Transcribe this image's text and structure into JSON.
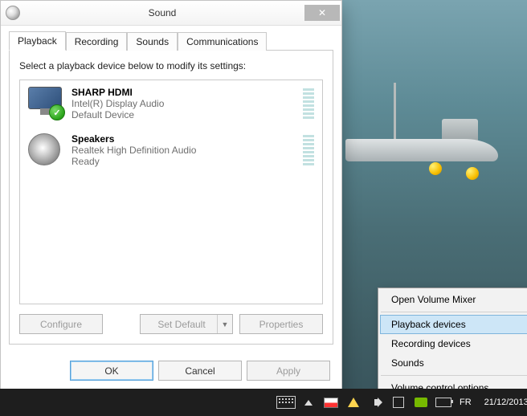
{
  "window": {
    "title": "Sound",
    "close_glyph": "✕"
  },
  "tabs": {
    "playback": "Playback",
    "recording": "Recording",
    "sounds": "Sounds",
    "communications": "Communications"
  },
  "instruction": "Select a playback device below to modify its settings:",
  "devices": [
    {
      "name": "SHARP HDMI",
      "sub": "Intel(R) Display Audio",
      "status": "Default Device",
      "default": true,
      "kind": "monitor"
    },
    {
      "name": "Speakers",
      "sub": "Realtek High Definition Audio",
      "status": "Ready",
      "default": false,
      "kind": "speaker"
    }
  ],
  "buttons": {
    "configure": "Configure",
    "set_default": "Set Default",
    "properties": "Properties",
    "ok": "OK",
    "cancel": "Cancel",
    "apply": "Apply"
  },
  "context_menu": {
    "open_mixer": "Open Volume Mixer",
    "playback": "Playback devices",
    "recording": "Recording devices",
    "sounds": "Sounds",
    "vol_options": "Volume control options"
  },
  "taskbar": {
    "lang": "FR",
    "date": "21/12/2013"
  }
}
